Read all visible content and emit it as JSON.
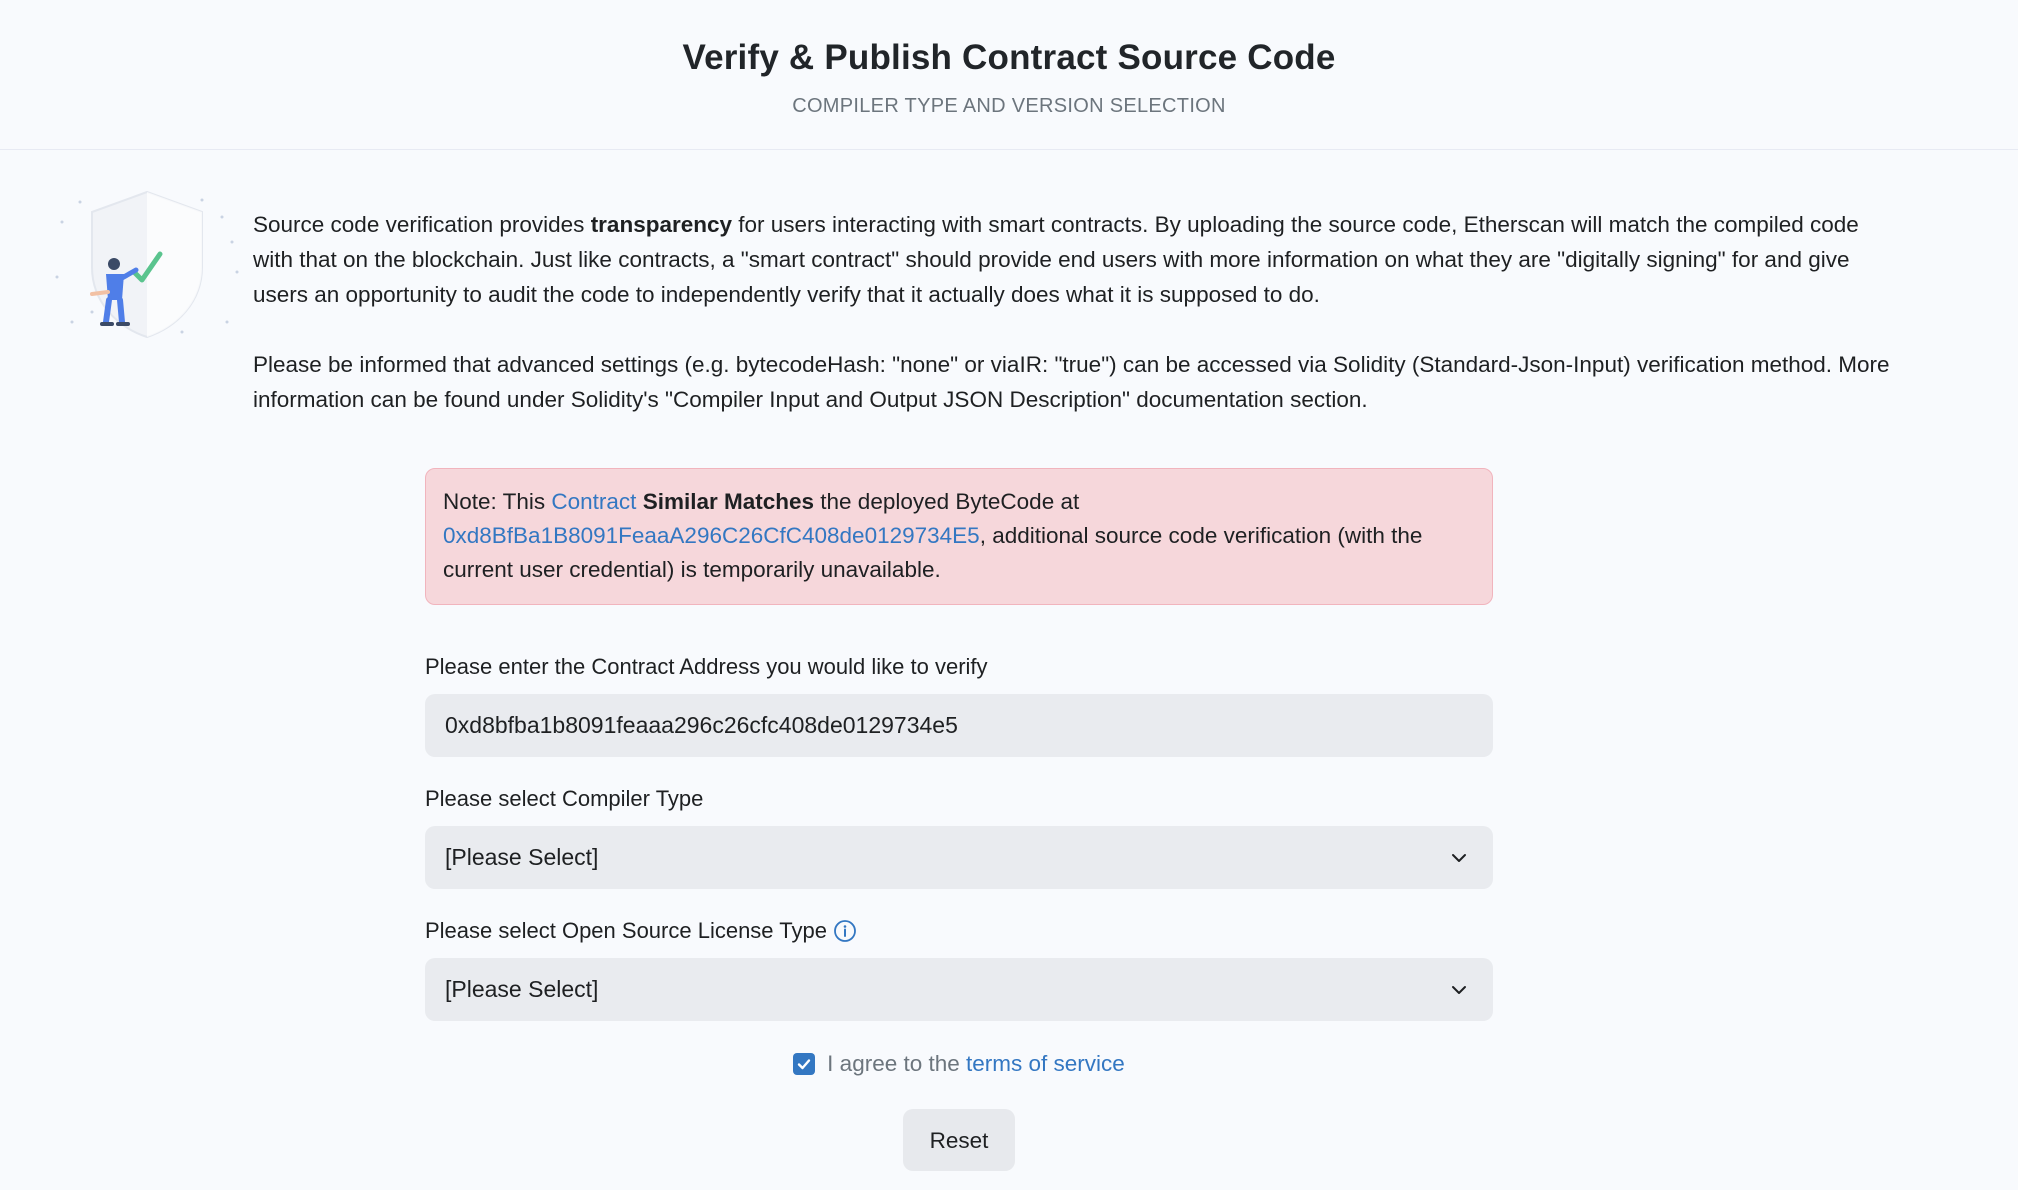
{
  "header": {
    "title": "Verify & Publish Contract Source Code",
    "subtitle": "COMPILER TYPE AND VERSION SELECTION"
  },
  "intro": {
    "p1_before": "Source code verification provides ",
    "p1_bold": "transparency",
    "p1_after": " for users interacting with smart contracts. By uploading the source code, Etherscan will match the compiled code with that on the blockchain. Just like contracts, a \"smart contract\" should provide end users with more information on what they are \"digitally signing\" for and give users an opportunity to audit the code to independently verify that it actually does what it is supposed to do.",
    "p2": "Please be informed that advanced settings (e.g. bytecodeHash: \"none\" or viaIR: \"true\") can be accessed via Solidity (Standard-Json-Input) verification method. More information can be found under Solidity's \"Compiler Input and Output JSON Description\" documentation section."
  },
  "alert": {
    "prefix": "Note: This ",
    "contract_link": "Contract",
    "bold": "Similar Matches",
    "middle": " the deployed ByteCode at ",
    "address_link": "0xd8BfBa1B8091FeaaA296C26CfC408de0129734E5",
    "suffix": ", additional source code verification (with the current user credential) is temporarily unavailable."
  },
  "form": {
    "address_label": "Please enter the Contract Address you would like to verify",
    "address_value": "0xd8bfba1b8091feaaa296c26cfc408de0129734e5",
    "compiler_label": "Please select Compiler Type",
    "compiler_value": "[Please Select]",
    "license_label": "Please select Open Source License Type",
    "license_value": "[Please Select]",
    "agree_text": "I agree to the ",
    "terms_link": "terms of service",
    "agree_checked": true,
    "reset_label": "Reset"
  },
  "colors": {
    "accent": "#3377c2",
    "alert_bg": "#f6d7db",
    "field_bg": "#e9ebef"
  }
}
